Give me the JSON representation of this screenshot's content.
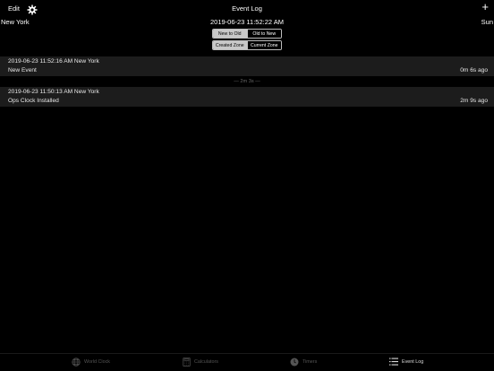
{
  "navbar": {
    "edit_label": "Edit",
    "title": "Event Log",
    "add_label": "+"
  },
  "header": {
    "zone": "New York",
    "current_time": "2019-06-23 11:52:22 AM",
    "day": "Sun"
  },
  "sort_segment": {
    "options": [
      "New to Old",
      "Old to New"
    ],
    "selected": "New to Old"
  },
  "zone_segment": {
    "options": [
      "Created Zone",
      "Current Zone"
    ],
    "selected": "Created Zone"
  },
  "events": [
    {
      "timestamp": "2019-06-23 11:52:16 AM  New York",
      "name": "New Event",
      "ago": "0m 6s ago"
    },
    {
      "timestamp": "2019-06-23 11:50:13 AM  New York",
      "name": "Ops Clock Installed",
      "ago": "2m 9s ago"
    }
  ],
  "gap_label": "— 2m 3s —",
  "tabs": [
    {
      "label": "World Clock",
      "icon": "globe-icon"
    },
    {
      "label": "Calculators",
      "icon": "calculator-icon"
    },
    {
      "label": "Timers",
      "icon": "timer-icon"
    },
    {
      "label": "Event Log",
      "icon": "list-icon"
    }
  ],
  "colors": {
    "background": "#000000",
    "row": "#1c1c1c",
    "segment_selected": "#c8c8c8",
    "tab_inactive": "#555555"
  }
}
